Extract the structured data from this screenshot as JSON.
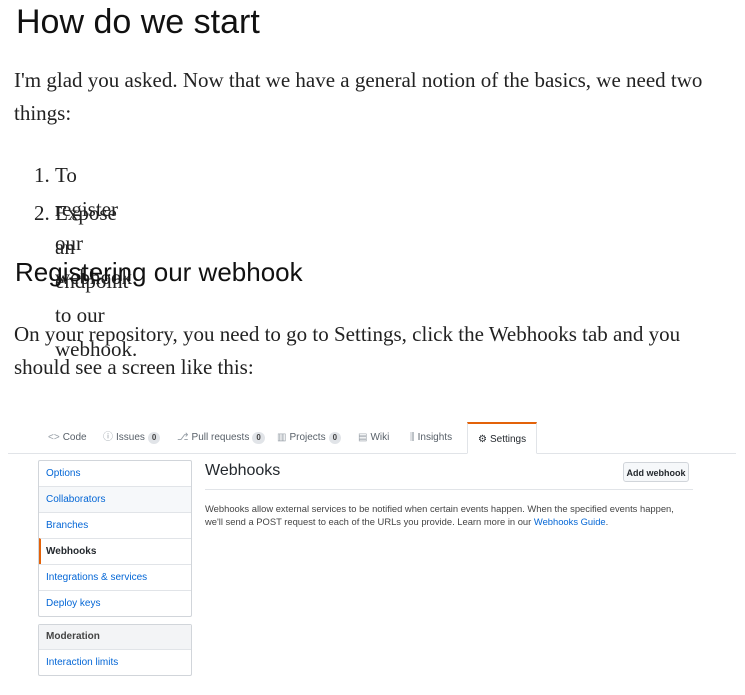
{
  "heading": "How do we start",
  "intro": "I'm glad you asked. Now that we have a general notion of the basics, we need two things:",
  "steps": [
    {
      "num": "1.",
      "text": "To register our webhook."
    },
    {
      "num": "2.",
      "text": "Expose an endpoint to our webhook."
    }
  ],
  "subheading": "Registering our webhook",
  "instructions": "On your repository, you need to go to Settings, click the Webhooks tab and you should see a screen like this:",
  "screenshot": {
    "tabs": [
      {
        "icon": "code-icon",
        "glyph": "<>",
        "label": "Code",
        "count": ""
      },
      {
        "icon": "issues-icon",
        "glyph": "ⓘ",
        "label": "Issues",
        "count": "0"
      },
      {
        "icon": "pull-request-icon",
        "glyph": "⎇",
        "label": "Pull requests",
        "count": "0"
      },
      {
        "icon": "projects-icon",
        "glyph": "▥",
        "label": "Projects",
        "count": "0"
      },
      {
        "icon": "wiki-icon",
        "glyph": "▤",
        "label": "Wiki",
        "count": ""
      },
      {
        "icon": "insights-icon",
        "glyph": "⫼",
        "label": "Insights",
        "count": ""
      },
      {
        "icon": "gear-icon",
        "glyph": "⚙",
        "label": "Settings",
        "count": ""
      }
    ],
    "settings_menu": [
      "Options",
      "Collaborators",
      "Branches",
      "Webhooks",
      "Integrations & services",
      "Deploy keys"
    ],
    "moderation_header": "Moderation",
    "moderation_items": [
      "Interaction limits"
    ],
    "webhooks_title": "Webhooks",
    "add_button": "Add webhook",
    "description": "Webhooks allow external services to be notified when certain events happen. When the specified events happen, we'll send a POST request to each of the URLs you provide. Learn more in our",
    "guide_link": "Webhooks Guide",
    "description_end": ".",
    "accent_color": "#e36209",
    "link_color": "#0366d6"
  }
}
